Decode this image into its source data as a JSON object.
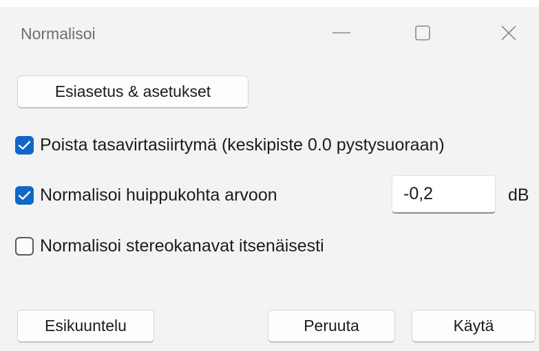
{
  "window": {
    "title": "Normalisoi"
  },
  "icons": {
    "minimize": "minimize-icon",
    "maximize": "maximize-icon",
    "close": "close-icon",
    "check": "checkmark-icon"
  },
  "colors": {
    "accent": "#1067c7",
    "background": "#f3f3f3"
  },
  "toolbar": {
    "preset_label": "Esiasetus & asetukset"
  },
  "options": {
    "remove_dc": {
      "label": "Poista tasavirtasiirtymä (keskipiste 0.0 pystysuoraan)",
      "checked": true
    },
    "normalize_peak": {
      "label": "Normalisoi huippukohta arvoon",
      "checked": true,
      "value": "-0,2",
      "unit": "dB"
    },
    "stereo_independent": {
      "label": "Normalisoi stereokanavat itsenäisesti",
      "checked": false
    }
  },
  "footer": {
    "preview_label": "Esikuuntelu",
    "cancel_label": "Peruuta",
    "apply_label": "Käytä"
  }
}
